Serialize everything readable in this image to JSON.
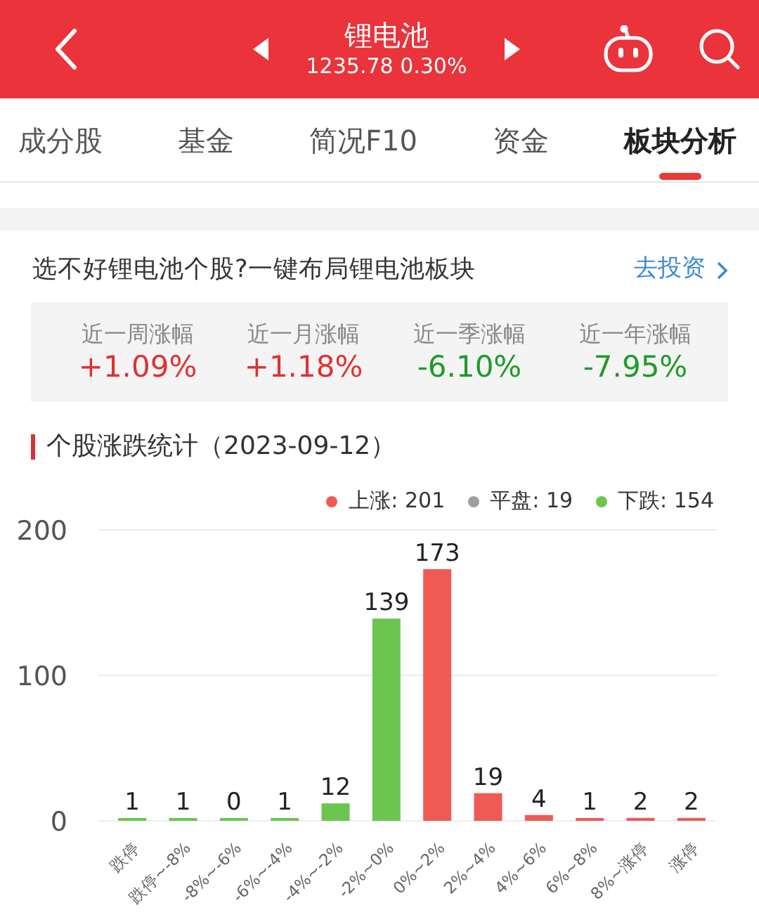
{
  "header": {
    "title": "锂电池",
    "quote": "1235.78 0.30%"
  },
  "tabs": [
    {
      "label": "成分股",
      "selected": false
    },
    {
      "label": "基金",
      "selected": false
    },
    {
      "label": "简况F10",
      "selected": false
    },
    {
      "label": "资金",
      "selected": false
    },
    {
      "label": "板块分析",
      "selected": true
    }
  ],
  "promo": {
    "text": "选不好锂电池个股?一键布局锂电池板块",
    "link": "去投资"
  },
  "returns": [
    {
      "label": "近一周涨幅",
      "value": "+1.09%",
      "color": "#e03131"
    },
    {
      "label": "近一月涨幅",
      "value": "+1.18%",
      "color": "#e03131"
    },
    {
      "label": "近一季涨幅",
      "value": "-6.10%",
      "color": "#1f9b28"
    },
    {
      "label": "近一年涨幅",
      "value": "-7.95%",
      "color": "#1f9b28"
    }
  ],
  "stats": {
    "title": "个股涨跌统计（2023-09-12）",
    "legend": [
      {
        "label": "上涨: 201",
        "color": "#f05a55"
      },
      {
        "label": "平盘: 19",
        "color": "#9e9e9e"
      },
      {
        "label": "下跌: 154",
        "color": "#6cc550"
      }
    ],
    "chart_data": {
      "type": "bar",
      "categories": [
        "跌停",
        "跌停~-8%",
        "-8%~-6%",
        "-6%~-4%",
        "-4%~-2%",
        "-2%~0%",
        "0%~2%",
        "2%~4%",
        "4%~6%",
        "6%~8%",
        "8%~涨停",
        "涨停"
      ],
      "series": [
        {
          "color": "#6cc550",
          "values": [
            1,
            1,
            0,
            1,
            12,
            139,
            null,
            null,
            null,
            null,
            null,
            null
          ]
        },
        {
          "color": "#f05a55",
          "values": [
            null,
            null,
            null,
            null,
            null,
            null,
            173,
            19,
            4,
            1,
            2,
            2
          ]
        }
      ],
      "ylim": [
        0,
        200
      ],
      "yticks": [
        0,
        100,
        200
      ],
      "data_labels": true
    }
  }
}
